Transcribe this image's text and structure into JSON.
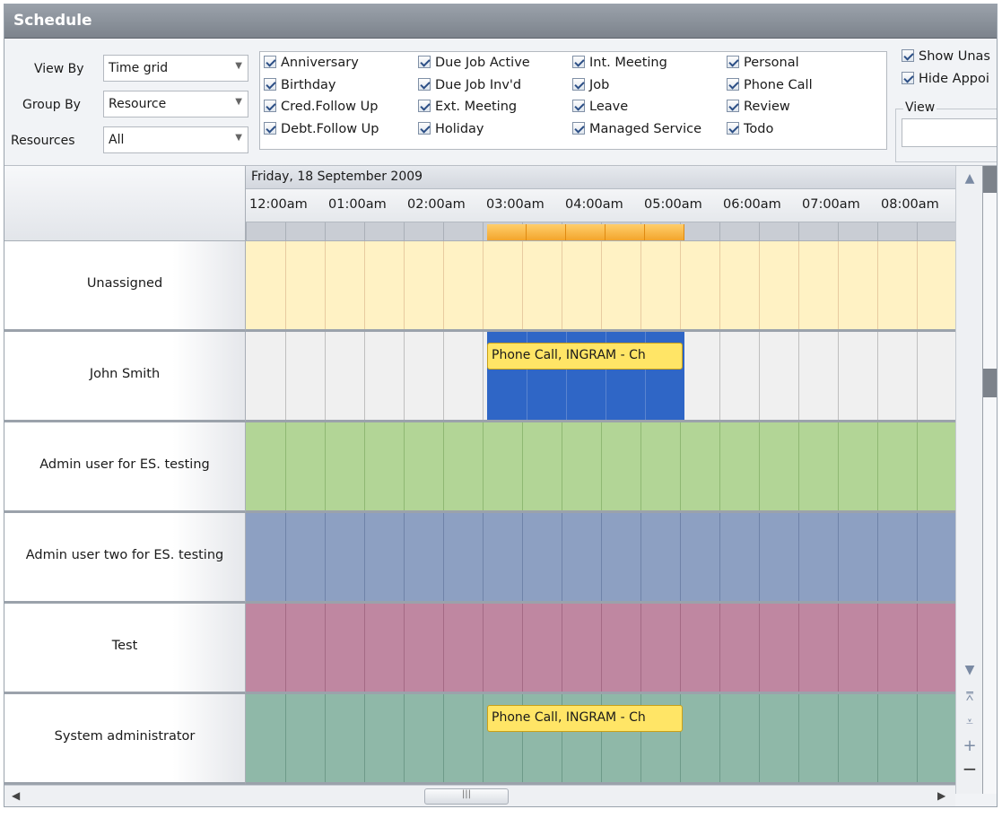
{
  "window": {
    "title": "Schedule"
  },
  "filters": {
    "view_by": {
      "label": "View By",
      "value": "Time grid"
    },
    "group_by": {
      "label": "Group By",
      "value": "Resource"
    },
    "resources": {
      "label": "Resources",
      "value": "All"
    },
    "categories": [
      [
        "Anniversary",
        "Birthday",
        "Cred.Follow Up",
        "Debt.Follow Up"
      ],
      [
        "Due Job Active",
        "Due Job Inv'd",
        "Ext. Meeting",
        "Holiday"
      ],
      [
        "Int. Meeting",
        "Job",
        "Leave",
        "Managed Service"
      ],
      [
        "Personal",
        "Phone Call",
        "Review",
        "Todo"
      ]
    ],
    "show_unassigned": "Show Unas",
    "hide_appointments": "Hide Appoi",
    "view_group_label": "View"
  },
  "schedule": {
    "date": "Friday, 18 September 2009",
    "times": [
      "12:00am",
      "01:00am",
      "02:00am",
      "03:00am",
      "04:00am",
      "05:00am",
      "06:00am",
      "07:00am",
      "08:00am"
    ],
    "resources": [
      {
        "name": "Unassigned",
        "bg": "#fff2c4",
        "line": "#e8cba0"
      },
      {
        "name": "John Smith",
        "bg": "#f0f0f0",
        "line": "#bfbfbf"
      },
      {
        "name": "Admin user for ES. testing",
        "bg": "#b2d596",
        "line": "#8fb873"
      },
      {
        "name": "Admin user two for ES. testing",
        "bg": "#8da0c2",
        "line": "#6f83a8"
      },
      {
        "name": "Test",
        "bg": "#bf87a1",
        "line": "#a46a85"
      },
      {
        "name": "System administrator",
        "bg": "#8fb8a8",
        "line": "#6e9a89"
      }
    ],
    "appointments": [
      {
        "resource": "John Smith",
        "text": "Phone Call, INGRAM - Ch"
      },
      {
        "resource": "System administrator",
        "text": "Phone Call, INGRAM - Ch"
      }
    ]
  },
  "icons": {
    "scroll_up": "triangle-up-icon",
    "scroll_down": "triangle-down-icon",
    "collapse_all": "collapse-all-icon",
    "expand_all": "expand-all-icon",
    "zoom_in": "plus-icon",
    "zoom_out": "minus-icon"
  }
}
